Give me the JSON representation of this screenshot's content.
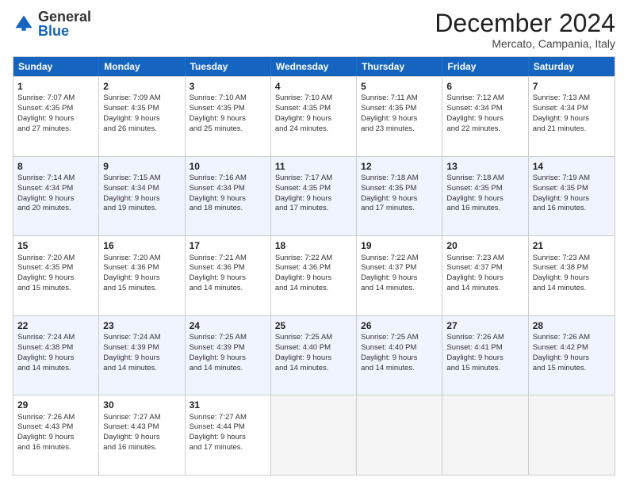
{
  "logo": {
    "general": "General",
    "blue": "Blue"
  },
  "title": "December 2024",
  "subtitle": "Mercato, Campania, Italy",
  "days": [
    "Sunday",
    "Monday",
    "Tuesday",
    "Wednesday",
    "Thursday",
    "Friday",
    "Saturday"
  ],
  "rows": [
    [
      {
        "day": "1",
        "lines": [
          "Sunrise: 7:07 AM",
          "Sunset: 4:35 PM",
          "Daylight: 9 hours",
          "and 27 minutes."
        ]
      },
      {
        "day": "2",
        "lines": [
          "Sunrise: 7:09 AM",
          "Sunset: 4:35 PM",
          "Daylight: 9 hours",
          "and 26 minutes."
        ]
      },
      {
        "day": "3",
        "lines": [
          "Sunrise: 7:10 AM",
          "Sunset: 4:35 PM",
          "Daylight: 9 hours",
          "and 25 minutes."
        ]
      },
      {
        "day": "4",
        "lines": [
          "Sunrise: 7:10 AM",
          "Sunset: 4:35 PM",
          "Daylight: 9 hours",
          "and 24 minutes."
        ]
      },
      {
        "day": "5",
        "lines": [
          "Sunrise: 7:11 AM",
          "Sunset: 4:35 PM",
          "Daylight: 9 hours",
          "and 23 minutes."
        ]
      },
      {
        "day": "6",
        "lines": [
          "Sunrise: 7:12 AM",
          "Sunset: 4:34 PM",
          "Daylight: 9 hours",
          "and 22 minutes."
        ]
      },
      {
        "day": "7",
        "lines": [
          "Sunrise: 7:13 AM",
          "Sunset: 4:34 PM",
          "Daylight: 9 hours",
          "and 21 minutes."
        ]
      }
    ],
    [
      {
        "day": "8",
        "lines": [
          "Sunrise: 7:14 AM",
          "Sunset: 4:34 PM",
          "Daylight: 9 hours",
          "and 20 minutes."
        ]
      },
      {
        "day": "9",
        "lines": [
          "Sunrise: 7:15 AM",
          "Sunset: 4:34 PM",
          "Daylight: 9 hours",
          "and 19 minutes."
        ]
      },
      {
        "day": "10",
        "lines": [
          "Sunrise: 7:16 AM",
          "Sunset: 4:34 PM",
          "Daylight: 9 hours",
          "and 18 minutes."
        ]
      },
      {
        "day": "11",
        "lines": [
          "Sunrise: 7:17 AM",
          "Sunset: 4:35 PM",
          "Daylight: 9 hours",
          "and 17 minutes."
        ]
      },
      {
        "day": "12",
        "lines": [
          "Sunrise: 7:18 AM",
          "Sunset: 4:35 PM",
          "Daylight: 9 hours",
          "and 17 minutes."
        ]
      },
      {
        "day": "13",
        "lines": [
          "Sunrise: 7:18 AM",
          "Sunset: 4:35 PM",
          "Daylight: 9 hours",
          "and 16 minutes."
        ]
      },
      {
        "day": "14",
        "lines": [
          "Sunrise: 7:19 AM",
          "Sunset: 4:35 PM",
          "Daylight: 9 hours",
          "and 16 minutes."
        ]
      }
    ],
    [
      {
        "day": "15",
        "lines": [
          "Sunrise: 7:20 AM",
          "Sunset: 4:35 PM",
          "Daylight: 9 hours",
          "and 15 minutes."
        ]
      },
      {
        "day": "16",
        "lines": [
          "Sunrise: 7:20 AM",
          "Sunset: 4:36 PM",
          "Daylight: 9 hours",
          "and 15 minutes."
        ]
      },
      {
        "day": "17",
        "lines": [
          "Sunrise: 7:21 AM",
          "Sunset: 4:36 PM",
          "Daylight: 9 hours",
          "and 14 minutes."
        ]
      },
      {
        "day": "18",
        "lines": [
          "Sunrise: 7:22 AM",
          "Sunset: 4:36 PM",
          "Daylight: 9 hours",
          "and 14 minutes."
        ]
      },
      {
        "day": "19",
        "lines": [
          "Sunrise: 7:22 AM",
          "Sunset: 4:37 PM",
          "Daylight: 9 hours",
          "and 14 minutes."
        ]
      },
      {
        "day": "20",
        "lines": [
          "Sunrise: 7:23 AM",
          "Sunset: 4:37 PM",
          "Daylight: 9 hours",
          "and 14 minutes."
        ]
      },
      {
        "day": "21",
        "lines": [
          "Sunrise: 7:23 AM",
          "Sunset: 4:38 PM",
          "Daylight: 9 hours",
          "and 14 minutes."
        ]
      }
    ],
    [
      {
        "day": "22",
        "lines": [
          "Sunrise: 7:24 AM",
          "Sunset: 4:38 PM",
          "Daylight: 9 hours",
          "and 14 minutes."
        ]
      },
      {
        "day": "23",
        "lines": [
          "Sunrise: 7:24 AM",
          "Sunset: 4:39 PM",
          "Daylight: 9 hours",
          "and 14 minutes."
        ]
      },
      {
        "day": "24",
        "lines": [
          "Sunrise: 7:25 AM",
          "Sunset: 4:39 PM",
          "Daylight: 9 hours",
          "and 14 minutes."
        ]
      },
      {
        "day": "25",
        "lines": [
          "Sunrise: 7:25 AM",
          "Sunset: 4:40 PM",
          "Daylight: 9 hours",
          "and 14 minutes."
        ]
      },
      {
        "day": "26",
        "lines": [
          "Sunrise: 7:25 AM",
          "Sunset: 4:40 PM",
          "Daylight: 9 hours",
          "and 14 minutes."
        ]
      },
      {
        "day": "27",
        "lines": [
          "Sunrise: 7:26 AM",
          "Sunset: 4:41 PM",
          "Daylight: 9 hours",
          "and 15 minutes."
        ]
      },
      {
        "day": "28",
        "lines": [
          "Sunrise: 7:26 AM",
          "Sunset: 4:42 PM",
          "Daylight: 9 hours",
          "and 15 minutes."
        ]
      }
    ],
    [
      {
        "day": "29",
        "lines": [
          "Sunrise: 7:26 AM",
          "Sunset: 4:43 PM",
          "Daylight: 9 hours",
          "and 16 minutes."
        ]
      },
      {
        "day": "30",
        "lines": [
          "Sunrise: 7:27 AM",
          "Sunset: 4:43 PM",
          "Daylight: 9 hours",
          "and 16 minutes."
        ]
      },
      {
        "day": "31",
        "lines": [
          "Sunrise: 7:27 AM",
          "Sunset: 4:44 PM",
          "Daylight: 9 hours",
          "and 17 minutes."
        ]
      },
      null,
      null,
      null,
      null
    ]
  ]
}
